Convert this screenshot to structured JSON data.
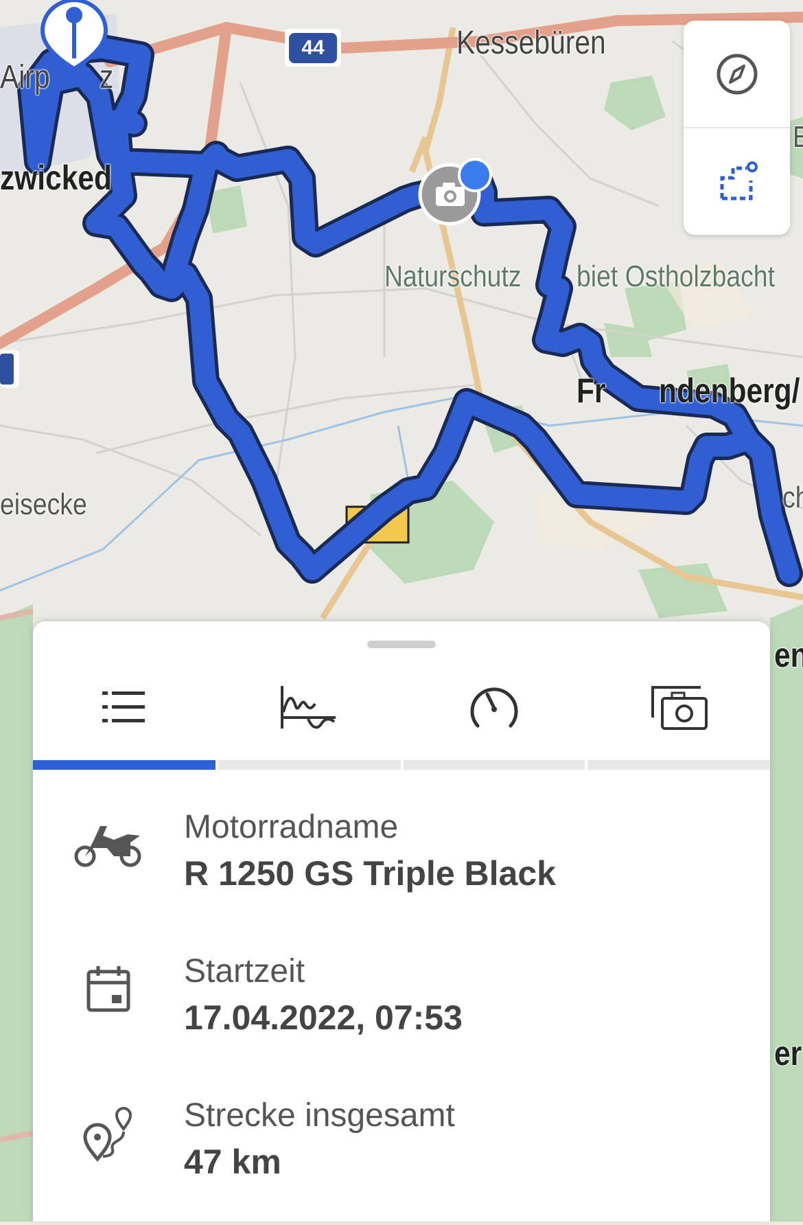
{
  "map": {
    "labels": {
      "kessebueren": "Kessebüren",
      "airport": "Airp",
      "airport_tail": "z",
      "zwickede": "zwicked",
      "naturschutz": "Naturschutz",
      "naturschutz_tail": "biet Ostholzbacht",
      "froendenberg_a": "Fr",
      "froendenberg_b": "ndenberg/",
      "eisecke": "eisecke",
      "right_e": "E",
      "right_ch": "ch",
      "right_en": "en",
      "right_er": "er"
    },
    "highway_shield": "44",
    "route_color": "#2f5fd3",
    "route_outline": "#1b2a55"
  },
  "map_controls": {
    "compass_icon": "compass-icon",
    "route_select_icon": "route-select-icon"
  },
  "sheet": {
    "tabs": [
      {
        "icon": "list-icon",
        "active": true
      },
      {
        "icon": "elevation-chart-icon",
        "active": false
      },
      {
        "icon": "speedometer-icon",
        "active": false
      },
      {
        "icon": "photos-icon",
        "active": false
      }
    ],
    "details": [
      {
        "icon": "motorcycle-icon",
        "label": "Motorradname",
        "value": "R 1250 GS Triple Black"
      },
      {
        "icon": "calendar-icon",
        "label": "Startzeit",
        "value": "17.04.2022, 07:53"
      },
      {
        "icon": "route-icon",
        "label": "Strecke insgesamt",
        "value": "47 km"
      }
    ]
  },
  "colors": {
    "accent": "#2d5fd6",
    "map_background": "#eceae4",
    "forest": "#b7d6b3",
    "motorway": "#e3a08a"
  }
}
